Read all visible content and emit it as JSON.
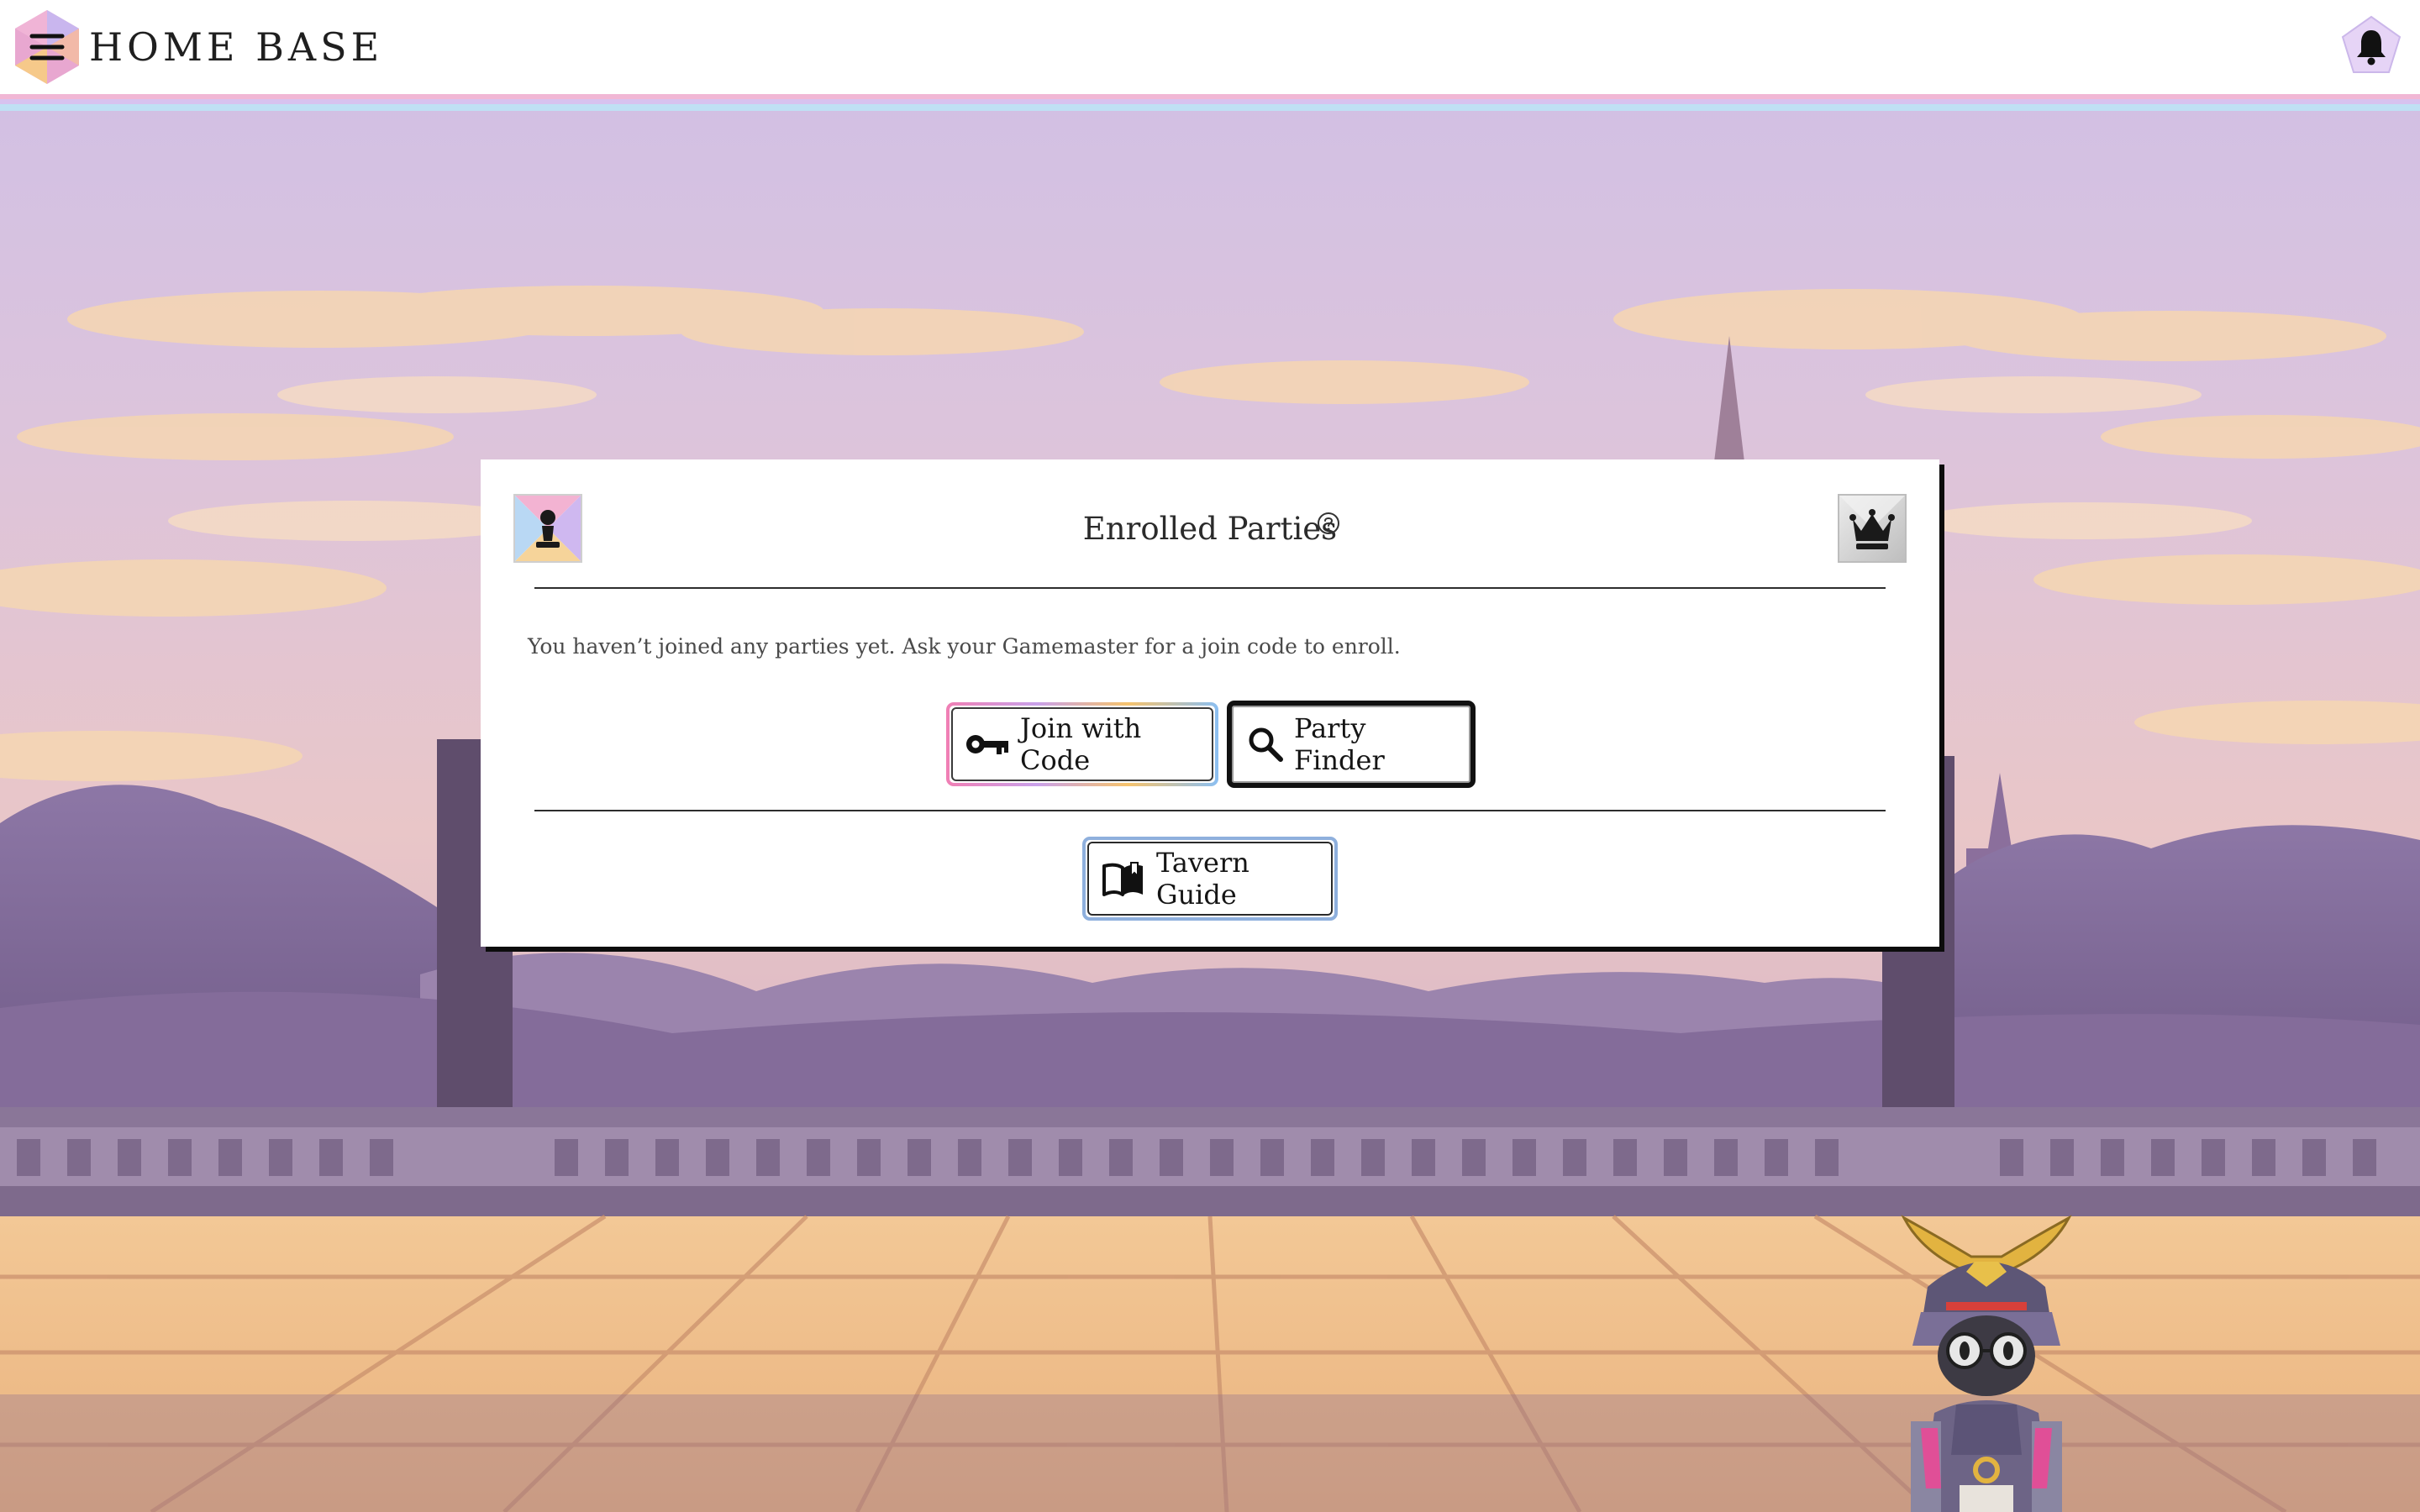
{
  "header": {
    "brand": "HOME BASE",
    "menu_icon": "hamburger-menu-icon",
    "notification_icon": "bell-icon"
  },
  "enrolled_parties": {
    "title": "Enrolled Parties",
    "help_icon": "question-circle-icon",
    "left_badge_icon": "pawn-icon",
    "right_badge_icon": "crown-icon",
    "empty_message": "You haven’t joined any parties yet. Ask your Gamemaster for a join code to enroll.",
    "join_button": {
      "label": "Join with Code",
      "icon": "key-icon"
    },
    "finder_button": {
      "label": "Party Finder",
      "icon": "search-icon"
    },
    "guide_button": {
      "label": "Tavern Guide",
      "icon": "open-book-icon"
    }
  },
  "colors": {
    "accent_pink": "#f07fb4",
    "accent_lavender": "#c9a1ea",
    "accent_gold": "#f6c36d",
    "accent_blue": "#8bbff2"
  }
}
